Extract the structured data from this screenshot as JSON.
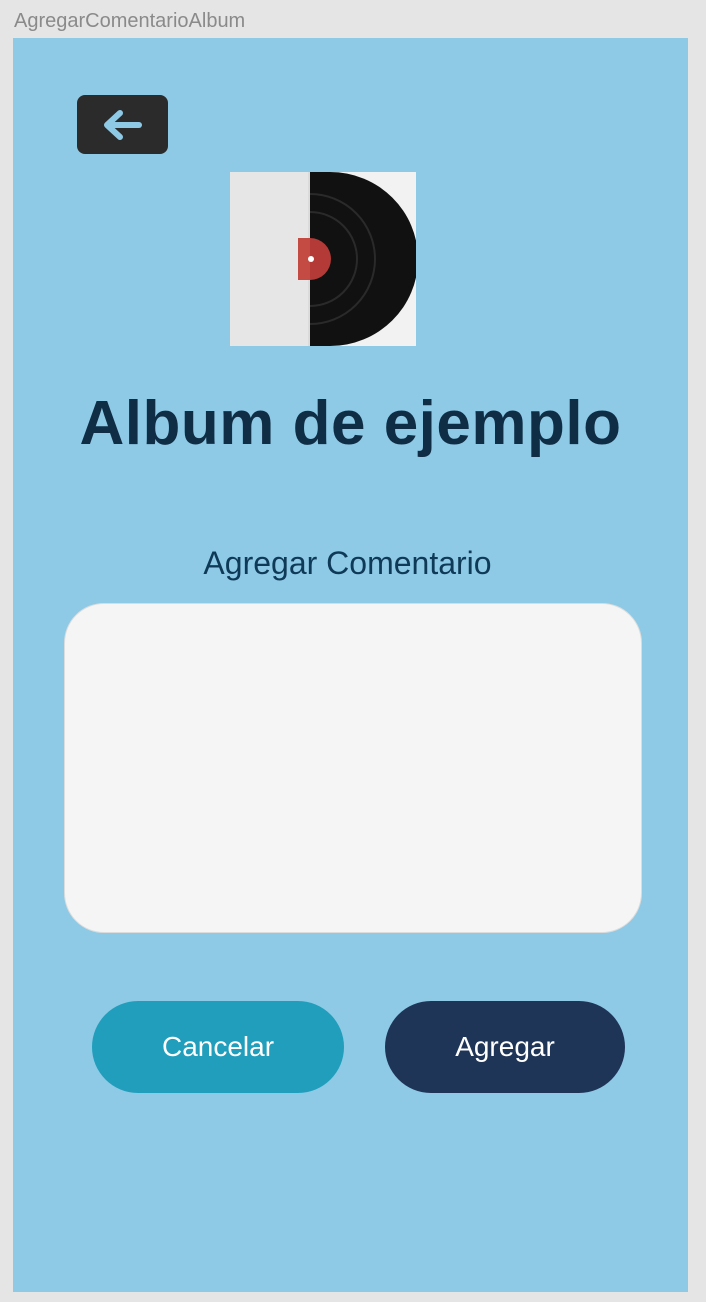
{
  "frame": {
    "label": "AgregarComentarioAlbum"
  },
  "header": {
    "back_icon": "arrow-left-icon"
  },
  "album": {
    "title": "Album de ejemplo",
    "cover_icon": "vinyl-record-image"
  },
  "comment": {
    "label": "Agregar Comentario",
    "value": "",
    "placeholder": ""
  },
  "actions": {
    "cancel_label": "Cancelar",
    "add_label": "Agregar"
  },
  "colors": {
    "background": "#8ecae6",
    "title": "#0f2d45",
    "cancel_button": "#219ebc",
    "add_button": "#1f3558",
    "back_button": "#2b2b2b"
  }
}
